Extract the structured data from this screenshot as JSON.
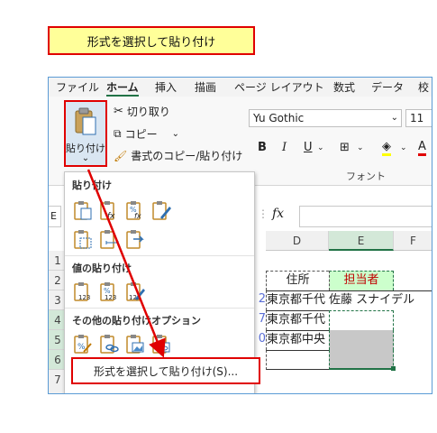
{
  "caption": "形式を選択して貼り付け",
  "ribbon_tabs": [
    "ファイル",
    "ホーム",
    "挿入",
    "描画",
    "ページ レイアウト",
    "数式",
    "データ",
    "校"
  ],
  "clipboard": {
    "paste_label": "貼り付け",
    "paste_caret": "⌄",
    "cut_label": "切り取り",
    "copy_label": "コピー",
    "copy_caret": "⌄",
    "format_painter_label": "書式のコピー/貼り付け"
  },
  "font": {
    "name": "Yu Gothic",
    "size": "11",
    "group_label": "フォント",
    "bold": "B",
    "italic": "I",
    "underline": "U",
    "font_color": "A"
  },
  "formula_bar": {
    "name_box_edge": "E",
    "fx": "fx"
  },
  "columns": [
    "D",
    "E",
    "F"
  ],
  "rows": [
    "1",
    "2",
    "3",
    "4",
    "5",
    "6",
    "7"
  ],
  "cells": {
    "d2": "住所",
    "e2": "担当者",
    "d3": "東京都千代",
    "e3": "佐藤 スナイデル",
    "d4": "東京都千代",
    "d5": "東京都中央",
    "c3_edge": "2",
    "c4_edge": "7",
    "c5_edge": "0"
  },
  "paste_menu": {
    "section_paste": "貼り付け",
    "section_values": "値の貼り付け",
    "section_other": "その他の貼り付けオプション",
    "special_button": "形式を選択して貼り付け(S)...",
    "paste_icons": [
      "paste-icon",
      "paste-formulas-icon",
      "paste-formulas-number-format-icon",
      "paste-keep-source-formatting-icon",
      "paste-no-borders-icon",
      "paste-keep-column-widths-icon",
      "paste-transpose-icon"
    ],
    "value_icons": [
      "paste-values-icon",
      "paste-values-number-format-icon",
      "paste-values-source-formatting-icon"
    ],
    "other_icons": [
      "paste-formatting-icon",
      "paste-link-icon",
      "paste-picture-icon",
      "paste-linked-picture-icon"
    ],
    "icon_sub_123": "123",
    "icon_sub_pct": "%",
    "icon_sub_fx": "fx"
  },
  "colors": {
    "highlight_red": "#e00000",
    "caption_bg": "#ffff99",
    "header_green": "#ccffcc",
    "excel_green": "#217346"
  }
}
